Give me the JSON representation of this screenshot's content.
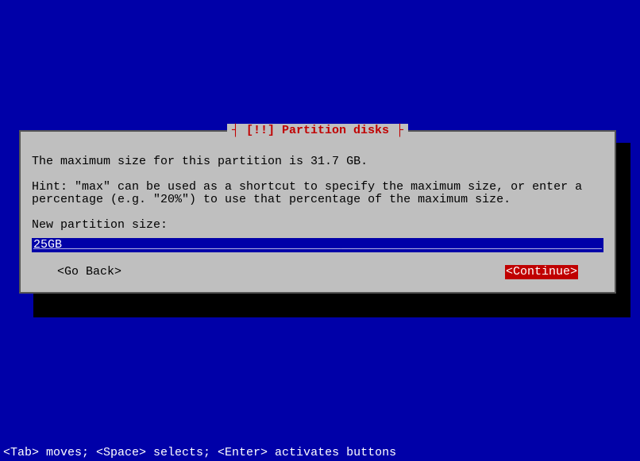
{
  "dialog": {
    "title_decor_left": "┤ ",
    "title": "[!!] Partition disks",
    "title_decor_right": " ├",
    "max_size_text": "The maximum size for this partition is 31.7 GB.",
    "hint_text": "Hint: \"max\" can be used as a shortcut to specify the maximum size, or enter a percentage (e.g. \"20%\") to use that percentage of the maximum size.",
    "prompt": "New partition size:",
    "input_value": "25GB",
    "go_back_label": "<Go Back>",
    "continue_label": "<Continue>"
  },
  "statusbar": {
    "text": "<Tab> moves; <Space> selects; <Enter> activates buttons"
  }
}
